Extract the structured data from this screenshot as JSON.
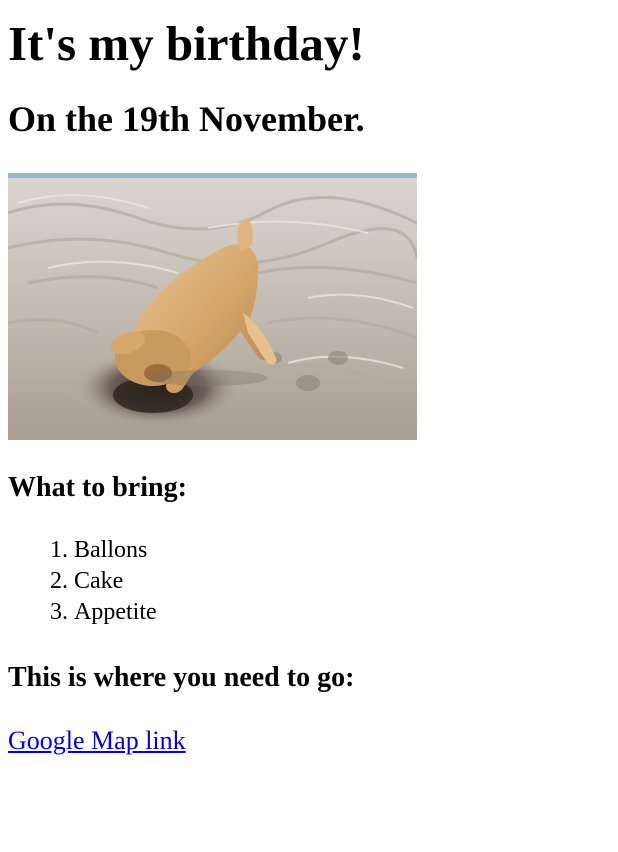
{
  "heading": "It's my birthday!",
  "date_heading": "On the 19th November.",
  "photo": {
    "subject": "puppy digging in sand on a beach"
  },
  "bring": {
    "heading": "What to bring:",
    "items": [
      "Ballons",
      "Cake",
      "Appetite"
    ]
  },
  "directions": {
    "heading": "This is where you need to go:",
    "link_label": "Google Map link"
  },
  "colors": {
    "link": "#0000ee",
    "text": "#000000",
    "background": "#ffffff"
  }
}
